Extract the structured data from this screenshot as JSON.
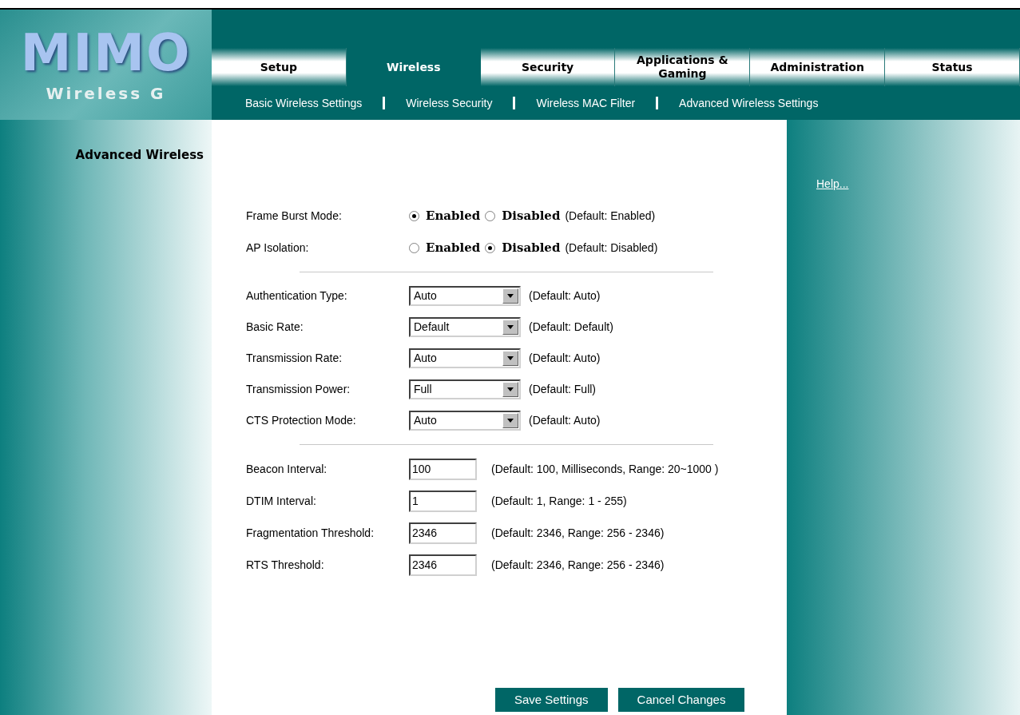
{
  "logo": {
    "title": "MIMO",
    "subtitle": "Wireless G"
  },
  "tabs": [
    {
      "label": "Setup",
      "selected": false
    },
    {
      "label": "Wireless",
      "selected": true
    },
    {
      "label": "Security",
      "selected": false
    },
    {
      "label": "Applications & Gaming",
      "selected": false
    },
    {
      "label": "Administration",
      "selected": false
    },
    {
      "label": "Status",
      "selected": false
    }
  ],
  "subnav": [
    {
      "label": "Basic Wireless Settings"
    },
    {
      "label": "Wireless Security"
    },
    {
      "label": "Wireless MAC Filter"
    },
    {
      "label": "Advanced Wireless Settings"
    }
  ],
  "sidebar": {
    "title": "Advanced Wireless"
  },
  "help": {
    "label": "Help..."
  },
  "sections": [
    {
      "kind": "radio",
      "rows": [
        {
          "label": "Frame Burst Mode:",
          "options": [
            {
              "label": "Enabled",
              "selected": true
            },
            {
              "label": "Disabled",
              "selected": false
            }
          ],
          "hint": "(Default: Enabled)"
        },
        {
          "label": "AP Isolation:",
          "options": [
            {
              "label": "Enabled",
              "selected": false
            },
            {
              "label": "Disabled",
              "selected": true
            }
          ],
          "hint": "(Default: Disabled)"
        }
      ]
    },
    {
      "kind": "select",
      "rows": [
        {
          "label": "Authentication Type:",
          "value": "Auto",
          "hint": "(Default: Auto)"
        },
        {
          "label": "Basic Rate:",
          "value": "Default",
          "hint": "(Default: Default)"
        },
        {
          "label": "Transmission Rate:",
          "value": "Auto",
          "hint": "(Default: Auto)"
        },
        {
          "label": "Transmission Power:",
          "value": "Full",
          "hint": "(Default: Full)"
        },
        {
          "label": "CTS Protection Mode:",
          "value": "Auto",
          "hint": "(Default: Auto)"
        }
      ]
    },
    {
      "kind": "input",
      "rows": [
        {
          "label": "Beacon Interval:",
          "value": "100",
          "hint": "(Default: 100, Milliseconds, Range: 20~1000 )"
        },
        {
          "label": "DTIM Interval:",
          "value": "1",
          "hint": "(Default: 1, Range: 1 - 255)"
        },
        {
          "label": "Fragmentation Threshold:",
          "value": "2346",
          "hint": "(Default: 2346, Range: 256 - 2346)"
        },
        {
          "label": "RTS Threshold:",
          "value": "2346",
          "hint": "(Default: 2346, Range: 256 - 2346)"
        }
      ]
    }
  ],
  "buttons": [
    {
      "label": "Save Settings"
    },
    {
      "label": "Cancel Changes"
    }
  ]
}
